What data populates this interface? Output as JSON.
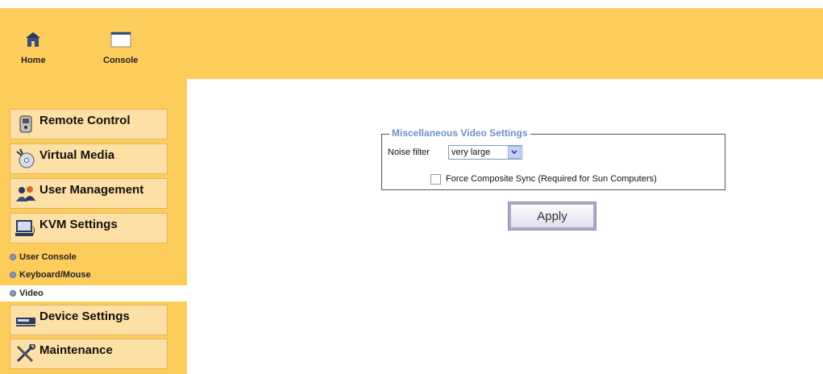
{
  "topnav": {
    "home_label": "Home",
    "console_label": "Console"
  },
  "sidebar": {
    "items": [
      {
        "label": "Remote Control",
        "icon": "remote-control-icon"
      },
      {
        "label": "Virtual Media",
        "icon": "virtual-media-icon"
      },
      {
        "label": "User Management",
        "icon": "user-management-icon"
      },
      {
        "label": "KVM Settings",
        "icon": "kvm-settings-icon"
      },
      {
        "label": "Device Settings",
        "icon": "device-settings-icon"
      },
      {
        "label": "Maintenance",
        "icon": "maintenance-icon"
      }
    ],
    "subitems": [
      {
        "label": "User Console",
        "active": false
      },
      {
        "label": "Keyboard/Mouse",
        "active": false
      },
      {
        "label": "Video",
        "active": true
      }
    ]
  },
  "video_settings": {
    "legend": "Miscellaneous Video Settings",
    "noise_filter_label": "Noise filter",
    "noise_filter_value": "very large",
    "force_sync_label": "Force Composite Sync (Required for Sun Computers)",
    "force_sync_checked": false,
    "apply_label": "Apply"
  },
  "colors": {
    "background_accent": "#fdcd5c",
    "menu_fill": "#fde0a6",
    "legend_text": "#6e8fc7"
  }
}
